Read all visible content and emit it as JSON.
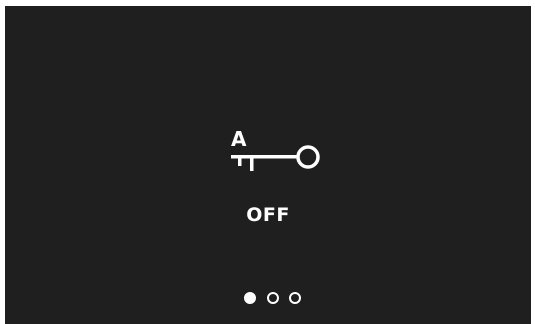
{
  "key": {
    "letter": "A",
    "icon": "key-icon"
  },
  "status": {
    "label": "OFF"
  },
  "pagination": {
    "total": 3,
    "active_index": 0
  },
  "colors": {
    "background": "#1f1f1f",
    "foreground": "#ffffff"
  }
}
